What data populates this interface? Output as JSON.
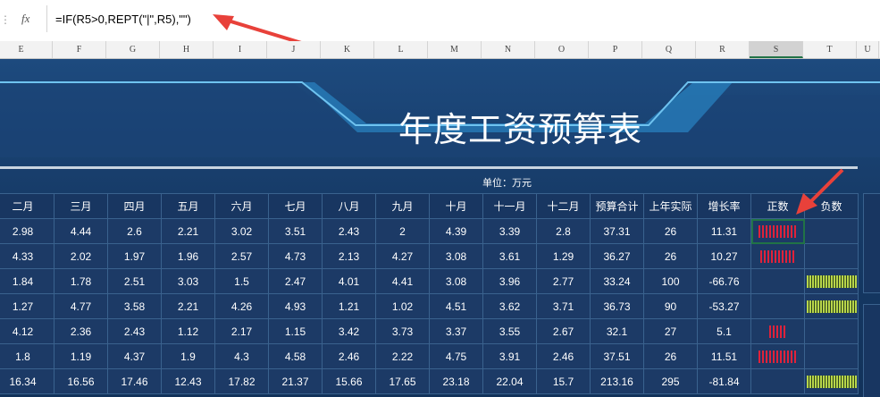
{
  "formula_bar": {
    "x_icon": "x-icon",
    "fx_label": "fx",
    "formula": "=IF(R5>0,REPT(\"|\",R5),\"\")"
  },
  "columns": [
    "E",
    "F",
    "G",
    "H",
    "I",
    "J",
    "K",
    "L",
    "M",
    "N",
    "O",
    "P",
    "Q",
    "R",
    "S",
    "T",
    "U"
  ],
  "selected_column": "S",
  "sheet": {
    "title": "年度工资预算表",
    "unit_label": "单位：万元",
    "headers": [
      "二月",
      "三月",
      "四月",
      "五月",
      "六月",
      "七月",
      "八月",
      "九月",
      "十月",
      "十一月",
      "十二月",
      "预算合计",
      "上年实际",
      "增长率",
      "正数",
      "负数"
    ],
    "rows": [
      {
        "v": [
          "2.98",
          "4.44",
          "2.6",
          "2.21",
          "3.02",
          "3.51",
          "2.43",
          "2",
          "4.39",
          "3.39",
          "2.8",
          "37.31",
          "26",
          "11.31"
        ],
        "pos": 11,
        "neg": 0
      },
      {
        "v": [
          "4.33",
          "2.02",
          "1.97",
          "1.96",
          "2.57",
          "4.73",
          "2.13",
          "4.27",
          "3.08",
          "3.61",
          "1.29",
          "36.27",
          "26",
          "10.27"
        ],
        "pos": 10,
        "neg": 0
      },
      {
        "v": [
          "1.84",
          "1.78",
          "2.51",
          "3.03",
          "1.5",
          "2.47",
          "4.01",
          "4.41",
          "3.08",
          "3.96",
          "2.77",
          "33.24",
          "100",
          "-66.76"
        ],
        "pos": 0,
        "neg": 66
      },
      {
        "v": [
          "1.27",
          "4.77",
          "3.58",
          "2.21",
          "4.26",
          "4.93",
          "1.21",
          "1.02",
          "4.51",
          "3.62",
          "3.71",
          "36.73",
          "90",
          "-53.27"
        ],
        "pos": 0,
        "neg": 53
      },
      {
        "v": [
          "4.12",
          "2.36",
          "2.43",
          "1.12",
          "2.17",
          "1.15",
          "3.42",
          "3.73",
          "3.37",
          "3.55",
          "2.67",
          "32.1",
          "27",
          "5.1"
        ],
        "pos": 5,
        "neg": 0
      },
      {
        "v": [
          "1.8",
          "1.19",
          "4.37",
          "1.9",
          "4.3",
          "4.58",
          "2.46",
          "2.22",
          "4.75",
          "3.91",
          "2.46",
          "37.51",
          "26",
          "11.51"
        ],
        "pos": 11,
        "neg": 0
      },
      {
        "v": [
          "16.34",
          "16.56",
          "17.46",
          "12.43",
          "17.82",
          "21.37",
          "15.66",
          "17.65",
          "23.18",
          "22.04",
          "15.7",
          "213.16",
          "295",
          "-81.84"
        ],
        "pos": 0,
        "neg": 81
      }
    ]
  },
  "colors": {
    "positive_bar": "#e0223a",
    "negative_bar": "#b8d64a",
    "sheet_bg": "#1c3a66",
    "selection": "#217346"
  }
}
